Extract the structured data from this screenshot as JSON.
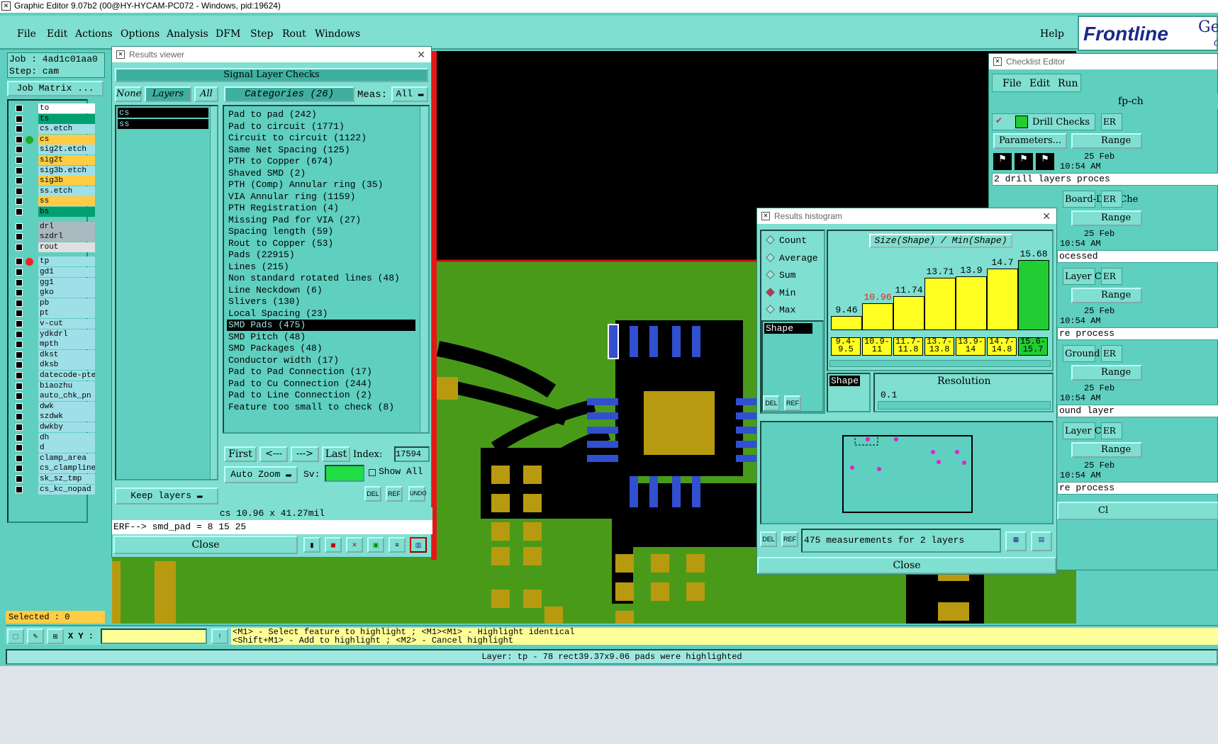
{
  "window": {
    "title": "Graphic Editor 9.07b2 (00@HY-HYCAM-PC072 - Windows, pid:19624)"
  },
  "menu": {
    "items": [
      "File",
      "Edit",
      "Actions",
      "Options",
      "Analysis",
      "DFM",
      "Step",
      "Rout",
      "Windows"
    ],
    "help": "Help",
    "brand": "Frontline",
    "brand_extra": "Ger",
    "brand_extra2": "G"
  },
  "job": {
    "label": "Job : 4ad1c01aa0",
    "step": "Step: cam",
    "matrix_button": "Job Matrix ..."
  },
  "layers": [
    {
      "name": "to",
      "color": "#ffffff"
    },
    {
      "name": "ts",
      "color": "#00a070"
    },
    {
      "name": "cs.etch",
      "color": "#9fe0e8"
    },
    {
      "name": "cs",
      "color": "#ffcc44"
    },
    {
      "name": "sig2t.etch",
      "color": "#9fe0e8"
    },
    {
      "name": "sig2t",
      "color": "#ffcc44"
    },
    {
      "name": "sig3b.etch",
      "color": "#9fe0e8"
    },
    {
      "name": "sig3b",
      "color": "#ffcc44"
    },
    {
      "name": "ss.etch",
      "color": "#9fe0e8"
    },
    {
      "name": "ss",
      "color": "#ffcc44"
    },
    {
      "name": "bs",
      "color": "#00a070"
    },
    {
      "name": "drl",
      "color": "#aab8c0"
    },
    {
      "name": "szdrl",
      "color": "#aab8c0"
    },
    {
      "name": "rout",
      "color": "#e0e0e0"
    },
    {
      "name": "tp",
      "color": "#9fe0e8"
    },
    {
      "name": "gd1",
      "color": "#9fe0e8"
    },
    {
      "name": "gg1",
      "color": "#9fe0e8"
    },
    {
      "name": "gko",
      "color": "#9fe0e8"
    },
    {
      "name": "pb",
      "color": "#9fe0e8"
    },
    {
      "name": "pt",
      "color": "#9fe0e8"
    },
    {
      "name": "v-cut",
      "color": "#9fe0e8"
    },
    {
      "name": "ydkdrl",
      "color": "#9fe0e8"
    },
    {
      "name": "mpth",
      "color": "#9fe0e8"
    },
    {
      "name": "dkst",
      "color": "#9fe0e8"
    },
    {
      "name": "dksb",
      "color": "#9fe0e8"
    },
    {
      "name": "datecode-pte",
      "color": "#9fe0e8"
    },
    {
      "name": "biaozhu",
      "color": "#9fe0e8"
    },
    {
      "name": "auto_chk_pn",
      "color": "#9fe0e8"
    },
    {
      "name": "dwk",
      "color": "#9fe0e8"
    },
    {
      "name": "szdwk",
      "color": "#9fe0e8"
    },
    {
      "name": "dwkby",
      "color": "#9fe0e8"
    },
    {
      "name": "dh",
      "color": "#9fe0e8"
    },
    {
      "name": "d",
      "color": "#9fe0e8"
    },
    {
      "name": "clamp_area",
      "color": "#9fe0e8"
    },
    {
      "name": "cs_clampline",
      "color": "#9fe0e8"
    },
    {
      "name": "sk_sz_tmp",
      "color": "#9fe0e8"
    },
    {
      "name": "cs_kc_nopad",
      "color": "#9fe0e8"
    }
  ],
  "selected": "Selected : 0",
  "results_viewer": {
    "title": "Results viewer",
    "heading": "Signal Layer Checks",
    "none_btn": "None",
    "layers_btn": "Layers",
    "all_btn": "All",
    "layer_list": [
      "cs",
      "ss"
    ],
    "categories_header": "Categories (26)",
    "meas_label": "Meas:",
    "meas_value": "All",
    "categories": [
      "Pad to pad (242)",
      "Pad to circuit (1771)",
      "Circuit to circuit (1122)",
      "Same Net Spacing (125)",
      "PTH to Copper (674)",
      "Shaved SMD (2)",
      "PTH (Comp) Annular ring (35)",
      "VIA Annular ring (1159)",
      "PTH Registration (4)",
      "Missing Pad for VIA (27)",
      "Spacing length (59)",
      "Rout to Copper (53)",
      "Pads (22915)",
      "Lines (215)",
      "Non standard rotated lines (48)",
      "Line Neckdown (6)",
      "Slivers (130)",
      "Local Spacing (23)",
      "SMD Pads (475)",
      "SMD Pitch (48)",
      "SMD Packages (48)",
      "Conductor width (17)",
      "Pad to Pad Connection (17)",
      "Pad to Cu Connection (244)",
      "Pad to Line Connection (2)",
      "Feature too small to check (8)"
    ],
    "selected_index": 18,
    "first_btn": "First",
    "prev_btn": "<---",
    "next_btn": "--->",
    "last_btn": "Last",
    "index_label": "Index:",
    "index_value": "17594",
    "auto_zoom": "Auto Zoom",
    "sv_label": "Sv:",
    "show_all": "Show All",
    "keep_layers": "Keep layers",
    "del": "DEL",
    "ref": "REF",
    "undo": "UNDO",
    "status": "cs 10.96 x 41.27mil",
    "erf": "ERF--> smd_pad = 8 15 25",
    "close": "Close"
  },
  "histogram": {
    "title": "Results histogram",
    "chart_title": "Size(Shape) / Min(Shape)",
    "modes": [
      "Count",
      "Average",
      "Sum",
      "Min",
      "Max"
    ],
    "selected_mode": "Min",
    "shape_list": [
      "Shape"
    ],
    "resolution_label": "Resolution",
    "resolution_value": "0.1",
    "shape_sel": "Shape",
    "del": "DEL",
    "ref": "REF",
    "summary": "475 measurements for 2 layers",
    "close": "Close"
  },
  "chart_data": {
    "type": "bar",
    "title": "Size(Shape) / Min(Shape)",
    "categories": [
      "9.4-\n9.5",
      "10.9-\n11",
      "11.7-\n11.8",
      "13.7-\n13.8",
      "13.9-\n14",
      "14.7-\n14.8",
      "15.6-\n15.7"
    ],
    "values": [
      9.46,
      10.96,
      11.74,
      13.71,
      13.9,
      14.7,
      15.68
    ],
    "value_labels": [
      "9.46",
      "10.96",
      "11.74",
      "13.71",
      "13.9",
      "14.7",
      "15.68"
    ],
    "highlight_value_index": 1,
    "last_bar_color": "#22cc33",
    "bar_color": "#ffff22"
  },
  "checklist": {
    "title": "Checklist Editor",
    "menu": [
      "File",
      "Edit",
      "Run"
    ],
    "name": "fp-ch",
    "items": [
      {
        "label": "Drill Checks",
        "er": "ER",
        "params": "Parameters...",
        "range": "Range",
        "date": "25 Feb",
        "time": "10:54 AM",
        "msg": "2 drill layers proces"
      },
      {
        "label": "Board-Drill Che",
        "er": "ER",
        "range": "Range",
        "date": "25 Feb",
        "time": "10:54 AM",
        "msg": "ocessed"
      },
      {
        "label": "Layer Ch",
        "er": "ER",
        "range": "Range",
        "date": "25 Feb",
        "time": "10:54 AM",
        "msg": "re process"
      },
      {
        "label": "Ground C",
        "er": "ER",
        "range": "Range",
        "date": "25 Feb",
        "time": "10:54 AM",
        "msg": "ound layer"
      },
      {
        "label": "Layer Ch",
        "er": "ER",
        "range": "Range",
        "date": "25 Feb",
        "time": "10:54 AM",
        "msg": "re process"
      }
    ],
    "close": "Cl"
  },
  "bottom": {
    "xy_label": "X Y :",
    "hint1": "<M1> - Select feature to highlight ; <M1><M1> - Highlight identical",
    "hint2": "<Shift+M1> - Add to highlight ; <M2> - Cancel highlight",
    "status": "Layer: tp - 78 rect39.37x9.06 pads were highlighted"
  },
  "colors": {
    "bg": "#5fcfbf",
    "canvas": "#4a9a1a",
    "copper": "#b89a10",
    "blue": "#3050d0"
  }
}
